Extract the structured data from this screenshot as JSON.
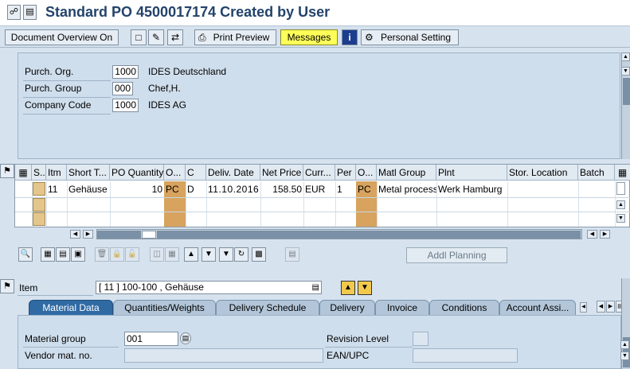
{
  "window": {
    "title": "Standard PO 4500017174 Created by User"
  },
  "toolbar": {
    "doc_overview": "Document Overview On",
    "print_preview": "Print Preview",
    "messages": "Messages",
    "personal_setting": "Personal Setting"
  },
  "header": {
    "fields": [
      {
        "label": "Purch. Org.",
        "code": "1000",
        "text": "IDES Deutschland"
      },
      {
        "label": "Purch. Group",
        "code": "000",
        "text": "Chef,H."
      },
      {
        "label": "Company Code",
        "code": "1000",
        "text": "IDES AG"
      }
    ]
  },
  "grid": {
    "columns": [
      "S..",
      "Itm",
      "Short T...",
      "PO Quantity",
      "O...",
      "C",
      "Deliv. Date",
      "Net Price",
      "Curr...",
      "Per",
      "O...",
      "Matl Group",
      "Plnt",
      "Stor. Location",
      "Batch"
    ],
    "rows": [
      {
        "itm": "11",
        "short_text": "Gehäuse",
        "qty": "10",
        "oun": "PC",
        "c": "D",
        "deliv_date": "11.10.2016",
        "net_price": "158.50",
        "curr": "EUR",
        "per": "1",
        "opu": "PC",
        "matl_group": "Metal processi",
        "plnt": "Werk Hamburg",
        "stor_loc": "",
        "batch": ""
      }
    ]
  },
  "addl_planning": "Addl Planning",
  "item": {
    "label": "Item",
    "selected": "[ 11 ] 100-100 , Gehäuse"
  },
  "tabs": [
    "Material Data",
    "Quantities/Weights",
    "Delivery Schedule",
    "Delivery",
    "Invoice",
    "Conditions",
    "Account Assi..."
  ],
  "material": {
    "material_group_label": "Material group",
    "material_group_value": "001",
    "revision_label": "Revision Level",
    "vendor_mat_label": "Vendor mat. no.",
    "ean_label": "EAN/UPC"
  }
}
